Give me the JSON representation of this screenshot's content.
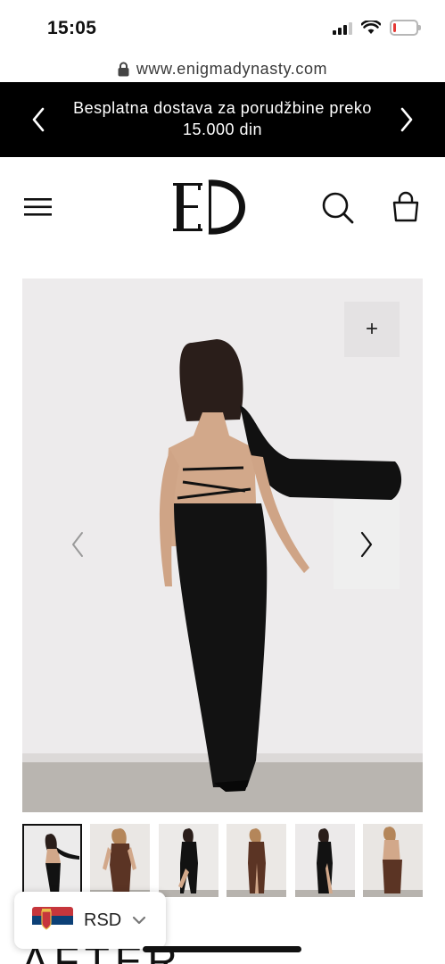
{
  "status_bar": {
    "time": "15:05",
    "battery_level_percent": 12,
    "signal_bars_filled": 3,
    "signal_bars_total": 4
  },
  "browser": {
    "url": "www.enigmadynasty.com"
  },
  "announcement": {
    "text": "Besplatna dostava za porudžbine preko 15.000 din"
  },
  "header": {
    "logo_text": "ED",
    "icons": [
      "menu-icon",
      "search-icon",
      "shopping-bag-icon"
    ]
  },
  "gallery": {
    "zoom_label": "+",
    "active_index": 0,
    "thumbnail_count": 6
  },
  "currency": {
    "code": "RSD",
    "flag": "serbia-flag"
  },
  "product": {
    "title_partial": "AFTER"
  },
  "colors": {
    "accent": "#000000",
    "announcement_bg": "#000000",
    "announcement_text": "#ffffff",
    "battery_low": "#e53935"
  }
}
